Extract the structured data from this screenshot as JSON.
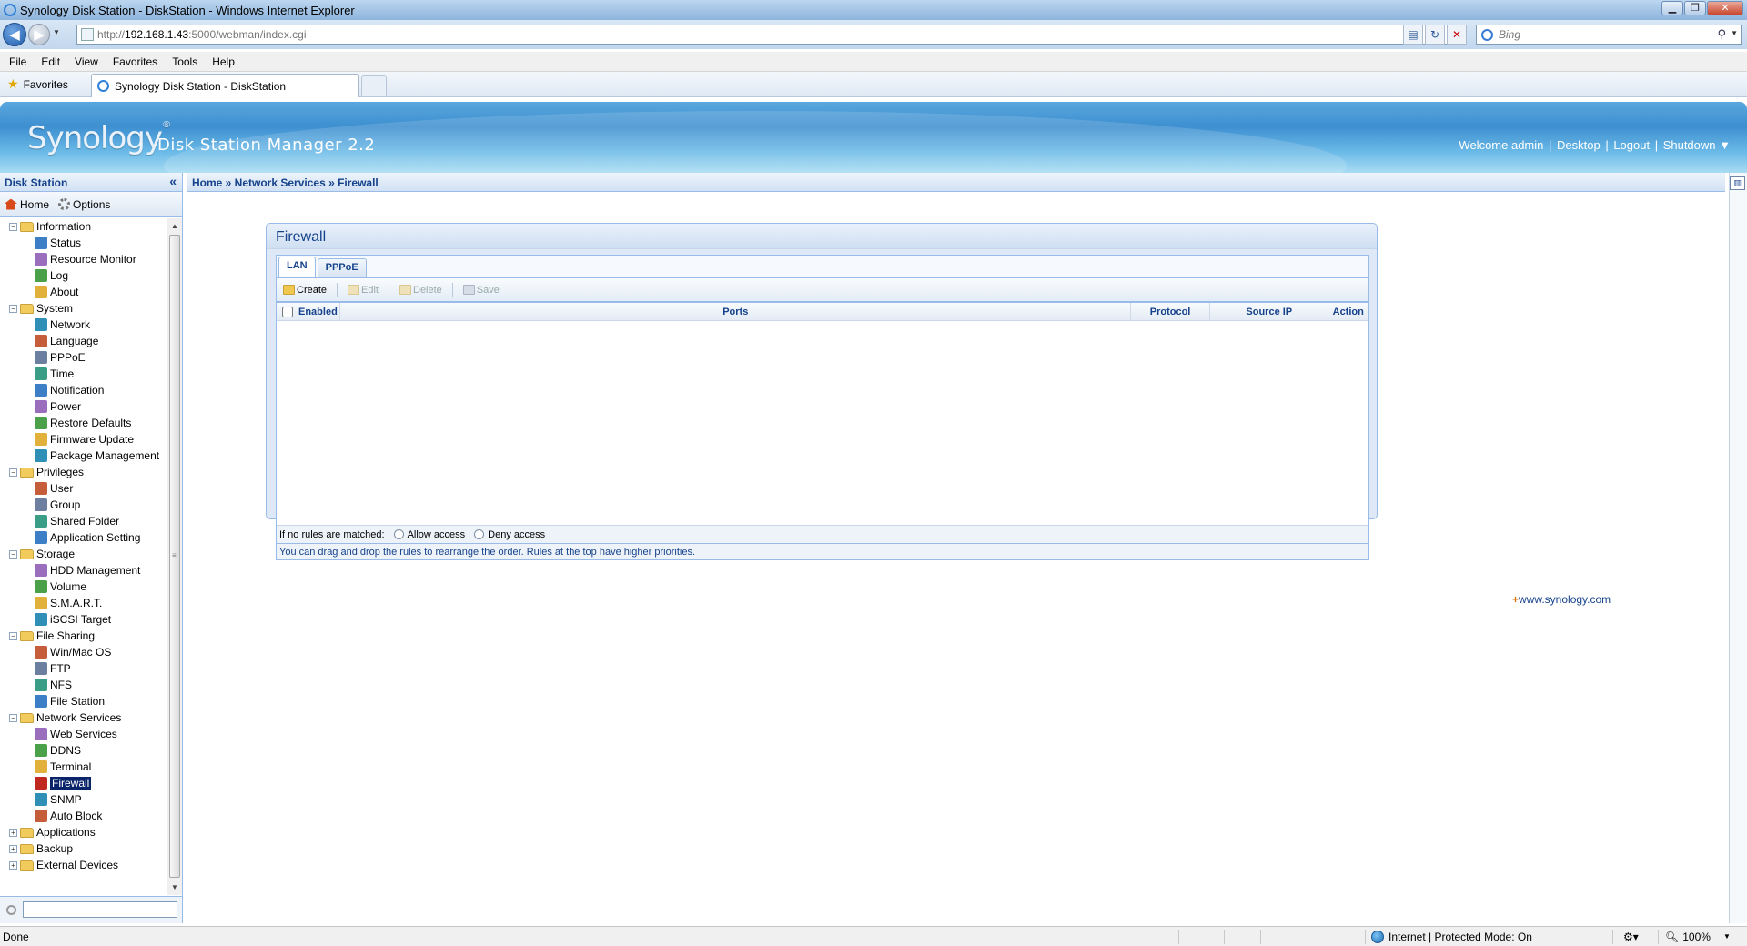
{
  "browser": {
    "window_title": "Synology Disk Station - DiskStation - Windows Internet Explorer",
    "url_prefix": "http://",
    "url_host": "192.168.1.43",
    "url_rest": ":5000/webman/index.cgi",
    "search_placeholder": "Bing",
    "menu": [
      "File",
      "Edit",
      "View",
      "Favorites",
      "Tools",
      "Help"
    ],
    "favorites_label": "Favorites",
    "tab_title": "Synology Disk Station - DiskStation",
    "status_left": "Done",
    "status_zone": "Internet | Protected Mode: On",
    "zoom": "100%"
  },
  "dsm": {
    "logo": "Synology",
    "product": "Disk Station Manager 2.2",
    "user_links": {
      "welcome": "Welcome admin",
      "desktop": "Desktop",
      "logout": "Logout",
      "shutdown": "Shutdown ▼"
    }
  },
  "sidebar": {
    "title": "Disk Station",
    "home_label": "Home",
    "options_label": "Options",
    "tree": [
      {
        "label": "Information",
        "expanded": true,
        "children": [
          {
            "label": "Status",
            "icon": "status-icon"
          },
          {
            "label": "Resource Monitor",
            "icon": "resource-monitor-icon"
          },
          {
            "label": "Log",
            "icon": "log-icon"
          },
          {
            "label": "About",
            "icon": "about-icon"
          }
        ]
      },
      {
        "label": "System",
        "expanded": true,
        "children": [
          {
            "label": "Network",
            "icon": "network-icon"
          },
          {
            "label": "Language",
            "icon": "language-icon"
          },
          {
            "label": "PPPoE",
            "icon": "pppoe-icon"
          },
          {
            "label": "Time",
            "icon": "time-icon"
          },
          {
            "label": "Notification",
            "icon": "notification-icon"
          },
          {
            "label": "Power",
            "icon": "power-icon"
          },
          {
            "label": "Restore Defaults",
            "icon": "restore-defaults-icon"
          },
          {
            "label": "Firmware Update",
            "icon": "firmware-update-icon"
          },
          {
            "label": "Package Management",
            "icon": "package-management-icon"
          }
        ]
      },
      {
        "label": "Privileges",
        "expanded": true,
        "children": [
          {
            "label": "User",
            "icon": "user-icon"
          },
          {
            "label": "Group",
            "icon": "group-icon"
          },
          {
            "label": "Shared Folder",
            "icon": "shared-folder-icon"
          },
          {
            "label": "Application Setting",
            "icon": "application-setting-icon"
          }
        ]
      },
      {
        "label": "Storage",
        "expanded": true,
        "children": [
          {
            "label": "HDD Management",
            "icon": "hdd-icon"
          },
          {
            "label": "Volume",
            "icon": "volume-icon"
          },
          {
            "label": "S.M.A.R.T.",
            "icon": "smart-icon"
          },
          {
            "label": "iSCSI Target",
            "icon": "iscsi-icon"
          }
        ]
      },
      {
        "label": "File Sharing",
        "expanded": true,
        "children": [
          {
            "label": "Win/Mac OS",
            "icon": "winmac-icon"
          },
          {
            "label": "FTP",
            "icon": "ftp-icon"
          },
          {
            "label": "NFS",
            "icon": "nfs-icon"
          },
          {
            "label": "File Station",
            "icon": "file-station-icon"
          }
        ]
      },
      {
        "label": "Network Services",
        "expanded": true,
        "children": [
          {
            "label": "Web Services",
            "icon": "web-services-icon"
          },
          {
            "label": "DDNS",
            "icon": "ddns-icon"
          },
          {
            "label": "Terminal",
            "icon": "terminal-icon"
          },
          {
            "label": "Firewall",
            "icon": "firewall-icon",
            "selected": true
          },
          {
            "label": "SNMP",
            "icon": "snmp-icon"
          },
          {
            "label": "Auto Block",
            "icon": "auto-block-icon"
          }
        ]
      },
      {
        "label": "Applications",
        "expanded": false,
        "children": []
      },
      {
        "label": "Backup",
        "expanded": false,
        "children": []
      },
      {
        "label": "External Devices",
        "expanded": false,
        "children": []
      }
    ]
  },
  "main": {
    "breadcrumb": "Home » Network Services » Firewall",
    "panel_title": "Firewall",
    "tabs": [
      "LAN",
      "PPPoE"
    ],
    "active_tab": "LAN",
    "toolbar": {
      "create": "Create",
      "edit": "Edit",
      "delete": "Delete",
      "save": "Save"
    },
    "columns": {
      "enabled": "Enabled",
      "ports": "Ports",
      "protocol": "Protocol",
      "source_ip": "Source IP",
      "action": "Action"
    },
    "no_match_label": "If no rules are matched:",
    "allow_label": "Allow access",
    "deny_label": "Deny access",
    "hint": "You can drag and drop the rules to rearrange the order. Rules at the top have higher priorities.",
    "synology_link": "www.synology.com"
  },
  "colors": {
    "dsm_blue": "#15428b",
    "header_blue": "#3d8fd0",
    "selection": "#0a246a"
  }
}
